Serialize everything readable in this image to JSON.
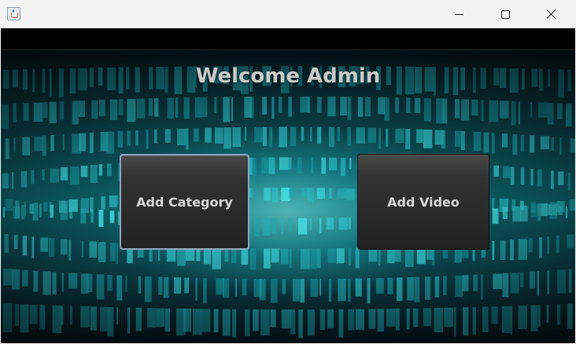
{
  "window": {
    "icon": "java-coffee-icon",
    "controls": [
      "minimize-icon",
      "maximize-icon",
      "close-icon"
    ]
  },
  "main": {
    "heading": "Welcome Admin",
    "buttons": {
      "add_category": "Add Category",
      "add_video": "Add Video"
    }
  },
  "colors": {
    "heading_text": "#c9c9c9",
    "button_bg": "#2a2a2a",
    "button_text": "#d8d8d8",
    "focus_border": "#8ca6c4",
    "background_accent": "#1fd3d6"
  }
}
